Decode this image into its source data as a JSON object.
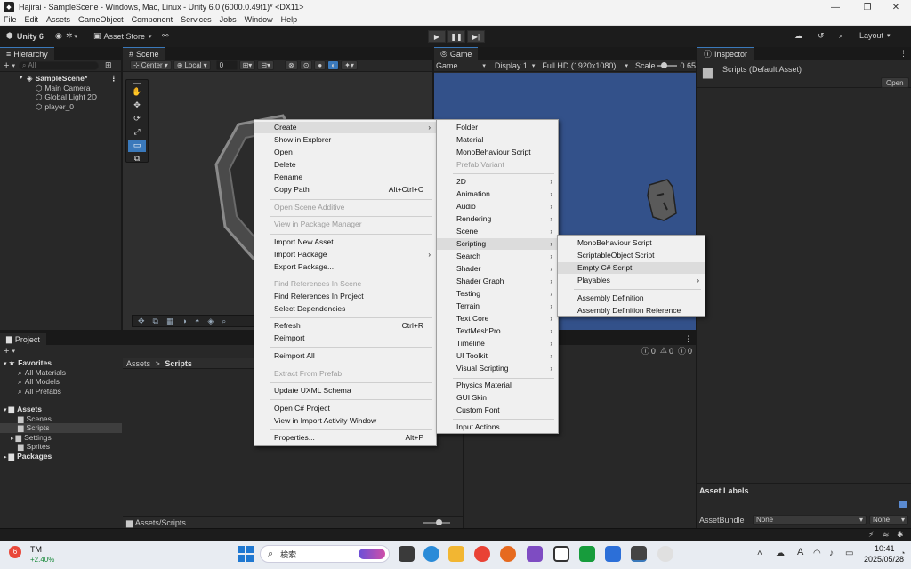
{
  "window": {
    "title": "Hajirai - SampleScene - Windows, Mac, Linux - Unity 6.0 (6000.0.49f1)* <DX11>"
  },
  "menubar": [
    "File",
    "Edit",
    "Assets",
    "GameObject",
    "Component",
    "Services",
    "Jobs",
    "Window",
    "Help"
  ],
  "toolbar": {
    "account": "Unity 6",
    "asset_store": "Asset Store",
    "layout": "Layout"
  },
  "hierarchy": {
    "tab": "Hierarchy",
    "search_placeholder": "All",
    "scene": "SampleScene*",
    "items": [
      "Main Camera",
      "Global Light 2D",
      "player_0"
    ]
  },
  "scene": {
    "tab": "Scene",
    "pivot": "Center",
    "space": "Local",
    "snap_value": "0"
  },
  "game": {
    "tab": "Game",
    "mode": "Game",
    "display": "Display 1",
    "resolution": "Full HD (1920x1080)",
    "scale_label": "Scale",
    "scale_value": "0.65"
  },
  "inspector": {
    "tab": "Inspector",
    "title": "Scripts (Default Asset)",
    "open_button": "Open",
    "asset_labels": "Asset Labels",
    "assetbundle_label": "AssetBundle",
    "assetbundle_value": "None",
    "variant_value": "None"
  },
  "project": {
    "tab": "Project",
    "favorites": {
      "label": "Favorites",
      "items": [
        "All Materials",
        "All Models",
        "All Prefabs"
      ]
    },
    "assets": {
      "label": "Assets",
      "items": [
        "Scenes",
        "Scripts",
        "Settings",
        "Sprites"
      ]
    },
    "packages": "Packages",
    "breadcrumb": [
      "Assets",
      "Scripts"
    ],
    "footer_path": "Assets/Scripts"
  },
  "console": {
    "errors": "0",
    "warnings": "0",
    "messages": "0"
  },
  "context_menu": [
    {
      "label": "Create",
      "submenu": true
    },
    {
      "label": "Show in Explorer"
    },
    {
      "label": "Open"
    },
    {
      "label": "Delete"
    },
    {
      "label": "Rename"
    },
    {
      "label": "Copy Path",
      "shortcut": "Alt+Ctrl+C"
    },
    {
      "label": "Open Scene Additive",
      "disabled": true
    },
    {
      "label": "View in Package Manager",
      "disabled": true
    },
    {
      "label": "Import New Asset..."
    },
    {
      "label": "Import Package",
      "submenu": true
    },
    {
      "label": "Export Package..."
    },
    {
      "label": "Find References In Scene",
      "disabled": true
    },
    {
      "label": "Find References In Project"
    },
    {
      "label": "Select Dependencies"
    },
    {
      "label": "Refresh",
      "shortcut": "Ctrl+R"
    },
    {
      "label": "Reimport"
    },
    {
      "label": "Reimport All"
    },
    {
      "label": "Extract From Prefab",
      "disabled": true
    },
    {
      "label": "Update UXML Schema"
    },
    {
      "label": "Open C# Project"
    },
    {
      "label": "View in Import Activity Window"
    },
    {
      "label": "Properties...",
      "shortcut": "Alt+P"
    }
  ],
  "create_menu": [
    {
      "label": "Folder"
    },
    {
      "label": "Material"
    },
    {
      "label": "MonoBehaviour Script"
    },
    {
      "label": "Prefab Variant",
      "disabled": true
    },
    {
      "label": "2D",
      "submenu": true
    },
    {
      "label": "Animation",
      "submenu": true
    },
    {
      "label": "Audio",
      "submenu": true
    },
    {
      "label": "Rendering",
      "submenu": true
    },
    {
      "label": "Scene",
      "submenu": true
    },
    {
      "label": "Scripting",
      "submenu": true
    },
    {
      "label": "Search",
      "submenu": true
    },
    {
      "label": "Shader",
      "submenu": true
    },
    {
      "label": "Shader Graph",
      "submenu": true
    },
    {
      "label": "Testing",
      "submenu": true
    },
    {
      "label": "Terrain",
      "submenu": true
    },
    {
      "label": "Text Core",
      "submenu": true
    },
    {
      "label": "TextMeshPro",
      "submenu": true
    },
    {
      "label": "Timeline",
      "submenu": true
    },
    {
      "label": "UI Toolkit",
      "submenu": true
    },
    {
      "label": "Visual Scripting",
      "submenu": true
    },
    {
      "label": "Physics Material"
    },
    {
      "label": "GUI Skin"
    },
    {
      "label": "Custom Font"
    },
    {
      "label": "Input Actions"
    }
  ],
  "scripting_menu": [
    {
      "label": "MonoBehaviour Script"
    },
    {
      "label": "ScriptableObject Script"
    },
    {
      "label": "Empty C# Script"
    },
    {
      "label": "Playables",
      "submenu": true
    },
    {
      "label": "Assembly Definition"
    },
    {
      "label": "Assembly Definition Reference"
    }
  ],
  "taskbar": {
    "stock_name": "TM",
    "stock_change": "+2.40%",
    "search": "検索",
    "time": "10:41",
    "date": "2025/05/28",
    "ime": "A",
    "badge": "6"
  }
}
